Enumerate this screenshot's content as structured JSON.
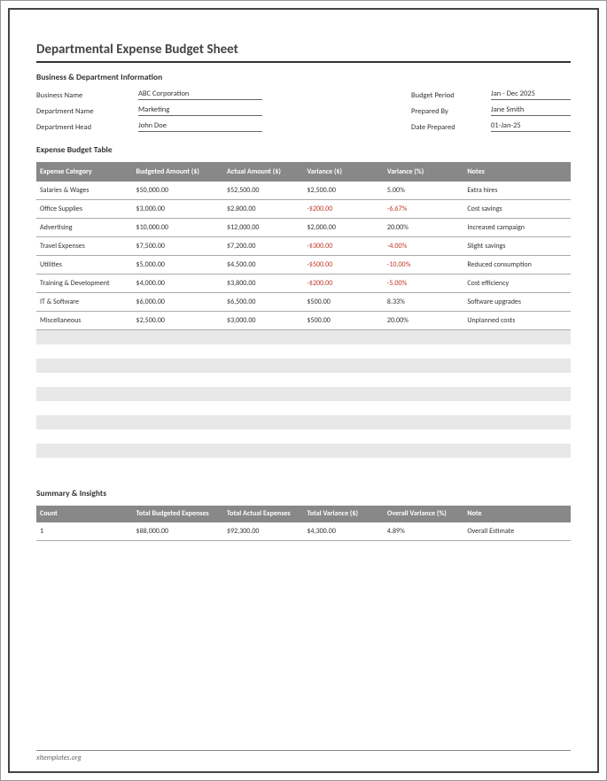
{
  "title": "Departmental Expense Budget Sheet",
  "section1_heading": "Business & Department Information",
  "info_left": [
    {
      "label": "Business Name",
      "value": "ABC Corporation"
    },
    {
      "label": "Department Name",
      "value": "Marketing"
    },
    {
      "label": "Department Head",
      "value": "John Doe"
    }
  ],
  "info_right": [
    {
      "label": "Budget Period",
      "value": "Jan - Dec 2025"
    },
    {
      "label": "Prepared By",
      "value": "Jane Smith"
    },
    {
      "label": "Date Prepared",
      "value": "01-Jan-25"
    }
  ],
  "section2_heading": "Expense Budget Table",
  "expense_headers": [
    "Expense Category",
    "Budgeted Amount ($)",
    "Actual Amount ($)",
    "Variance ($)",
    "Variance (%)",
    "Notes"
  ],
  "expense_rows": [
    {
      "cat": "Salaries & Wages",
      "bud": "$50,000.00",
      "act": "$52,500.00",
      "var": "$2,500.00",
      "pct": "5.00%",
      "notes": "Extra hires",
      "neg": false
    },
    {
      "cat": "Office Supplies",
      "bud": "$3,000.00",
      "act": "$2,800.00",
      "var": "-$200.00",
      "pct": "-6.67%",
      "notes": "Cost savings",
      "neg": true
    },
    {
      "cat": "Advertising",
      "bud": "$10,000.00",
      "act": "$12,000.00",
      "var": "$2,000.00",
      "pct": "20.00%",
      "notes": "Increased campaign",
      "neg": false
    },
    {
      "cat": "Travel Expenses",
      "bud": "$7,500.00",
      "act": "$7,200.00",
      "var": "-$300.00",
      "pct": "-4.00%",
      "notes": "Slight savings",
      "neg": true
    },
    {
      "cat": "Utilities",
      "bud": "$5,000.00",
      "act": "$4,500.00",
      "var": "-$500.00",
      "pct": "-10.00%",
      "notes": "Reduced consumption",
      "neg": true
    },
    {
      "cat": "Training & Development",
      "bud": "$4,000.00",
      "act": "$3,800.00",
      "var": "-$200.00",
      "pct": "-5.00%",
      "notes": "Cost efficiency",
      "neg": true
    },
    {
      "cat": "IT & Software",
      "bud": "$6,000.00",
      "act": "$6,500.00",
      "var": "$500.00",
      "pct": "8.33%",
      "notes": "Software upgrades",
      "neg": false
    },
    {
      "cat": "Miscellaneous",
      "bud": "$2,500.00",
      "act": "$3,000.00",
      "var": "$500.00",
      "pct": "20.00%",
      "notes": "Unplanned costs",
      "neg": false
    }
  ],
  "blank_row_count": 10,
  "section3_heading": "Summary & Insights",
  "summary_headers": [
    "Count",
    "Total Budgeted Expenses",
    "Total Actual Expenses",
    "Total Variance ($)",
    "Overall Variance (%)",
    "Note"
  ],
  "summary_row": {
    "count": "1",
    "bud": "$88,000.00",
    "act": "$92,300.00",
    "var": "$4,300.00",
    "pct": "4.89%",
    "note": "Overall Estimate"
  },
  "footer": "xltemplates.org"
}
